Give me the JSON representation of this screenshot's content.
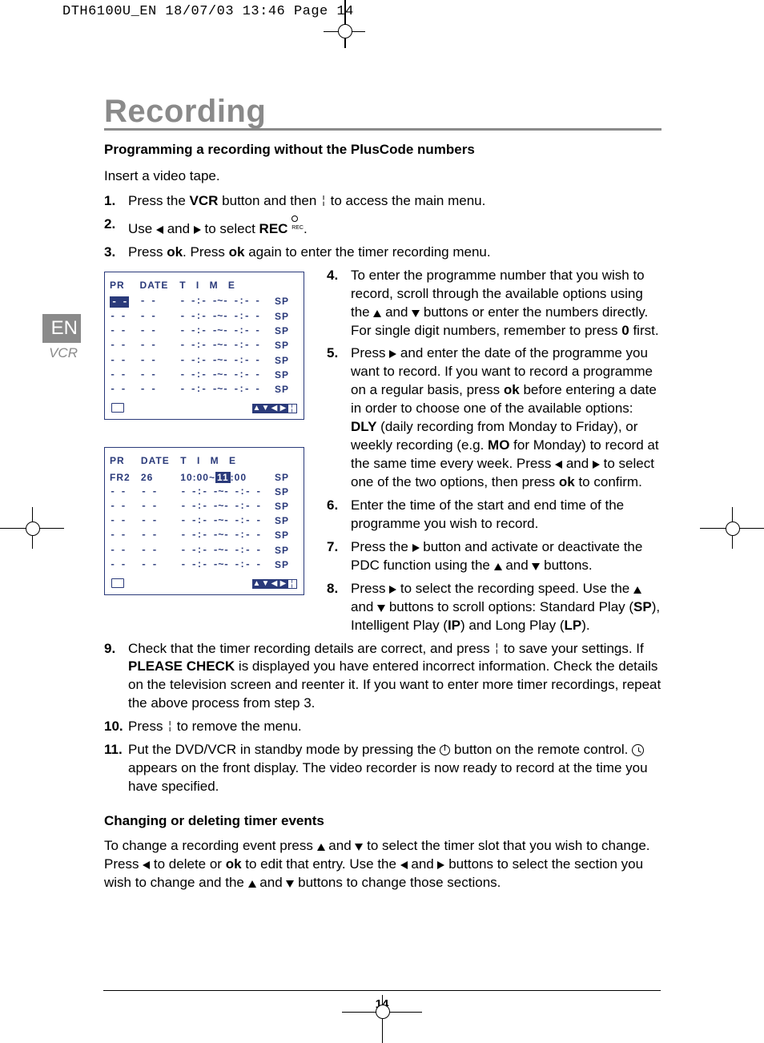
{
  "crop_header": "DTH6100U_EN  18/07/03  13:46  Page 14",
  "page_title": "Recording",
  "side_tab": {
    "lang": "EN",
    "device": "VCR"
  },
  "section1_title": "Programming a recording without the PlusCode numbers",
  "intro": "Insert a video tape.",
  "step1": {
    "num": "1.",
    "a": "Press the ",
    "b": "VCR",
    "c": " button and then ",
    "d": " to access the main menu."
  },
  "step2": {
    "num": "2.",
    "a": "Use ",
    "b": " and ",
    "c": " to select ",
    "d": "REC",
    "e": " "
  },
  "step3": {
    "num": "3.",
    "a": "Press ",
    "b": "ok",
    "c": ". Press ",
    "d": "ok",
    "e": " again to enter the timer recording menu."
  },
  "osd1": {
    "headers": {
      "pr": "PR",
      "date": "DATE",
      "time": "T I M E"
    },
    "rows": [
      {
        "pr": "- -",
        "date": "- -",
        "time": "- -:- -~- -:- -",
        "sp": "SP",
        "pr_hl": true
      },
      {
        "pr": "- -",
        "date": "- -",
        "time": "- -:- -~- -:- -",
        "sp": "SP"
      },
      {
        "pr": "- -",
        "date": "- -",
        "time": "- -:- -~- -:- -",
        "sp": "SP"
      },
      {
        "pr": "- -",
        "date": "- -",
        "time": "- -:- -~- -:- -",
        "sp": "SP"
      },
      {
        "pr": "- -",
        "date": "- -",
        "time": "- -:- -~- -:- -",
        "sp": "SP"
      },
      {
        "pr": "- -",
        "date": "- -",
        "time": "- -:- -~- -:- -",
        "sp": "SP"
      },
      {
        "pr": "- -",
        "date": "- -",
        "time": "- -:- -~- -:- -",
        "sp": "SP"
      }
    ]
  },
  "osd2": {
    "headers": {
      "pr": "PR",
      "date": "DATE",
      "time": "T I M E"
    },
    "rows": [
      {
        "pr": "FR2",
        "date": "26",
        "time_a": "10:00~",
        "time_hl": "11",
        "time_b": ":00",
        "sp": "SP"
      },
      {
        "pr": "- -",
        "date": "- -",
        "time": "- -:- -~- -:- -",
        "sp": "SP"
      },
      {
        "pr": "- -",
        "date": "- -",
        "time": "- -:- -~- -:- -",
        "sp": "SP"
      },
      {
        "pr": "- -",
        "date": "- -",
        "time": "- -:- -~- -:- -",
        "sp": "SP"
      },
      {
        "pr": "- -",
        "date": "- -",
        "time": "- -:- -~- -:- -",
        "sp": "SP"
      },
      {
        "pr": "- -",
        "date": "- -",
        "time": "- -:- -~- -:- -",
        "sp": "SP"
      },
      {
        "pr": "- -",
        "date": "- -",
        "time": "- -:- -~- -:- -",
        "sp": "SP"
      }
    ]
  },
  "step4": {
    "num": "4.",
    "a": "To enter the programme number that you wish to record, scroll through the available options using the ",
    "b": " and ",
    "c": " buttons or enter the numbers directly. For single digit numbers, remember to press ",
    "d": "0",
    "e": " first."
  },
  "step5": {
    "num": "5.",
    "a": "Press ",
    "b": " and enter the date of the programme you want to record. If you want to record a programme on a regular basis, press ",
    "c": "ok",
    "d": " before entering a date in order to choose one of the available options: ",
    "e": "DLY",
    "f": " (daily recording from Monday to Friday), or weekly recording (e.g. ",
    "g": "MO",
    "h": " for Monday) to record at the same time every week. Press ",
    "i": " and ",
    "j": " to select one of the two options, then press ",
    "k": "ok",
    "l": " to confirm."
  },
  "step6": {
    "num": "6.",
    "a": "Enter the time of the start and end time of the programme you wish to record."
  },
  "step7": {
    "num": "7.",
    "a": "Press the ",
    "b": " button and activate or deactivate the PDC function using the ",
    "c": " and ",
    "d": " buttons."
  },
  "step8": {
    "num": "8.",
    "a": "Press ",
    "b": " to select the recording speed. Use the ",
    "c": " and ",
    "d": " buttons to scroll options: Standard Play (",
    "e": "SP",
    "f": "), Intelligent Play (",
    "g": "IP",
    "h": ") and Long Play (",
    "i": "LP",
    "j": ")."
  },
  "step9": {
    "num": "9.",
    "a": "Check that the timer recording details are correct, and press ",
    "b": " to save your settings. If ",
    "c": "PLEASE CHECK",
    "d": " is displayed you have entered incorrect information. Check the details on the television screen and reenter it. If you want to enter more timer recordings, repeat the above process from step 3."
  },
  "step10": {
    "num": "10.",
    "a": "Press ",
    "b": " to remove the menu."
  },
  "step11": {
    "num": "11.",
    "a": "Put the DVD/VCR in standby mode by pressing the ",
    "b": " button on the remote control. ",
    "c": " appears on the front display. The video recorder is now ready to record at the time you have specified."
  },
  "section2_title": "Changing or deleting timer events",
  "section2_p": {
    "a": "To change a recording event press ",
    "b": " and ",
    "c": " to select the timer slot that you wish to change. Press ",
    "d": " to delete or ",
    "e": "ok",
    "f": " to edit that entry. Use the ",
    "g": " and ",
    "h": " buttons to select the section you wish to change and the ",
    "i": " and ",
    "j": " buttons to change those sections."
  },
  "rec_label": "REC",
  "page_number": "14"
}
